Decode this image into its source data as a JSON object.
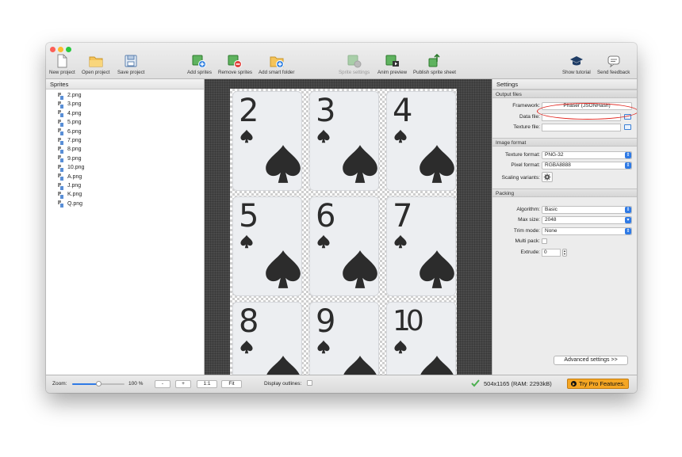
{
  "toolbar": {
    "buttons": [
      {
        "label": "New project",
        "icon": "new-project-icon"
      },
      {
        "label": "Open project",
        "icon": "open-folder-icon"
      },
      {
        "label": "Save project",
        "icon": "save-icon"
      },
      {
        "label": "Add sprites",
        "icon": "add-sprites-icon"
      },
      {
        "label": "Remove sprites",
        "icon": "remove-sprites-icon"
      },
      {
        "label": "Add smart folder",
        "icon": "smart-folder-icon"
      },
      {
        "label": "Sprite settings",
        "icon": "sprite-settings-icon",
        "disabled": true
      },
      {
        "label": "Anim preview",
        "icon": "anim-preview-icon"
      },
      {
        "label": "Publish sprite sheet",
        "icon": "publish-icon"
      },
      {
        "label": "Show tutorial",
        "icon": "tutorial-cap-icon"
      },
      {
        "label": "Send feedback",
        "icon": "feedback-icon"
      }
    ]
  },
  "sprites_panel": {
    "title": "Sprites",
    "items": [
      "2.png",
      "3.png",
      "4.png",
      "5.png",
      "6.png",
      "7.png",
      "8.png",
      "9.png",
      "10.png",
      "A.png",
      "J.png",
      "K.png",
      "Q.png"
    ]
  },
  "canvas": {
    "cards": [
      "2",
      "3",
      "4",
      "5",
      "6",
      "7",
      "8",
      "9",
      "10"
    ]
  },
  "settings": {
    "title": "Settings",
    "output_files": {
      "header": "Output files",
      "framework_label": "Framework:",
      "framework_value": "Phaser (JSONHash)",
      "data_file_label": "Data file:",
      "data_file_value": "",
      "texture_file_label": "Texture file:",
      "texture_file_value": ""
    },
    "image_format": {
      "header": "Image format",
      "texture_format_label": "Texture format:",
      "texture_format_value": "PNG-32",
      "pixel_format_label": "Pixel format:",
      "pixel_format_value": "RGBA8888",
      "scaling_label": "Scaling variants:"
    },
    "packing": {
      "header": "Packing",
      "algorithm_label": "Algorithm:",
      "algorithm_value": "Basic",
      "max_size_label": "Max size:",
      "max_size_value": "2048",
      "trim_mode_label": "Trim mode:",
      "trim_mode_value": "None",
      "multi_pack_label": "Multi pack:",
      "extrude_label": "Extrude:",
      "extrude_value": "0"
    },
    "advanced_button": "Advanced settings >>"
  },
  "statusbar": {
    "zoom_label": "Zoom:",
    "zoom_value": "100 %",
    "zoom_level": 0.5,
    "minus_label": "-",
    "plus_label": "+",
    "one_to_one_label": "1:1",
    "fit_label": "Fit",
    "outlines_label": "Display outlines:",
    "size_info": "504x1165 (RAM: 2293kB)",
    "pro_label": "Try Pro Features."
  }
}
